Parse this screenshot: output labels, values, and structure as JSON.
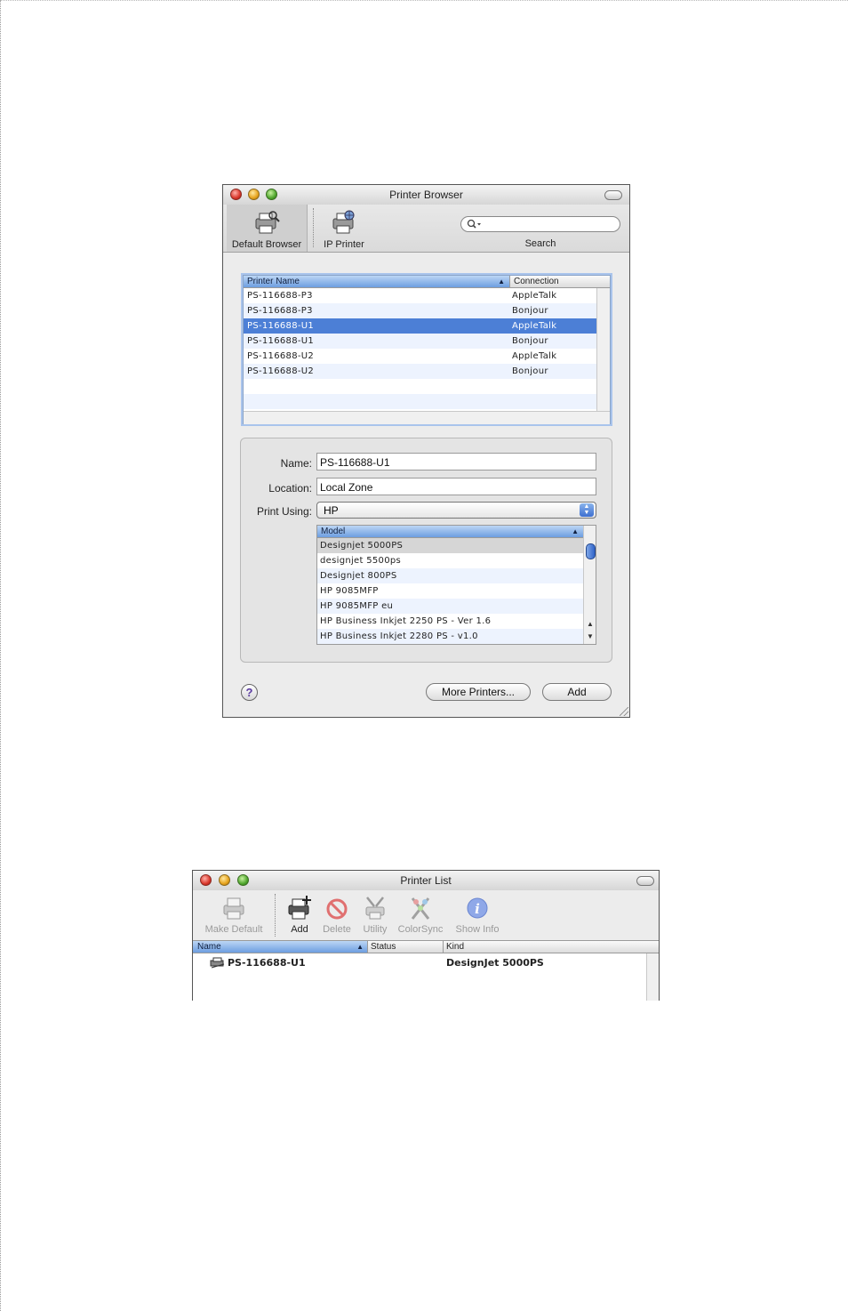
{
  "printer_browser": {
    "title": "Printer Browser",
    "toolbar": {
      "default_browser": "Default Browser",
      "ip_printer": "IP Printer",
      "search_label": "Search",
      "search_value": ""
    },
    "printer_table": {
      "columns": {
        "name": "Printer Name",
        "connection": "Connection"
      },
      "rows": [
        {
          "name": "PS-116688-P3",
          "connection": "AppleTalk"
        },
        {
          "name": "PS-116688-P3",
          "connection": "Bonjour"
        },
        {
          "name": "PS-116688-U1",
          "connection": "AppleTalk"
        },
        {
          "name": "PS-116688-U1",
          "connection": "Bonjour"
        },
        {
          "name": "PS-116688-U2",
          "connection": "AppleTalk"
        },
        {
          "name": "PS-116688-U2",
          "connection": "Bonjour"
        }
      ]
    },
    "details": {
      "name_label": "Name:",
      "name_value": "PS-116688-U1",
      "location_label": "Location:",
      "location_value": "Local Zone",
      "print_using_label": "Print Using:",
      "print_using_value": "HP"
    },
    "model_table": {
      "column": "Model",
      "rows": [
        "Designjet 5000PS",
        "designjet 5500ps",
        "Designjet 800PS",
        "HP 9085MFP",
        "HP 9085MFP eu",
        "HP Business Inkjet 2250 PS - Ver 1.6",
        "HP Business Inkjet 2280 PS - v1.0"
      ]
    },
    "help_symbol": "?",
    "more_printers_button": "More Printers...",
    "add_button": "Add"
  },
  "printer_list": {
    "title": "Printer List",
    "toolbar": {
      "make_default": "Make Default",
      "add": "Add",
      "delete": "Delete",
      "utility": "Utility",
      "colorsync": "ColorSync",
      "show_info": "Show Info"
    },
    "columns": {
      "name": "Name",
      "status": "Status",
      "kind": "Kind"
    },
    "rows": [
      {
        "name": "PS-116688-U1",
        "status": "",
        "kind": "DesignJet 5000PS"
      }
    ]
  }
}
